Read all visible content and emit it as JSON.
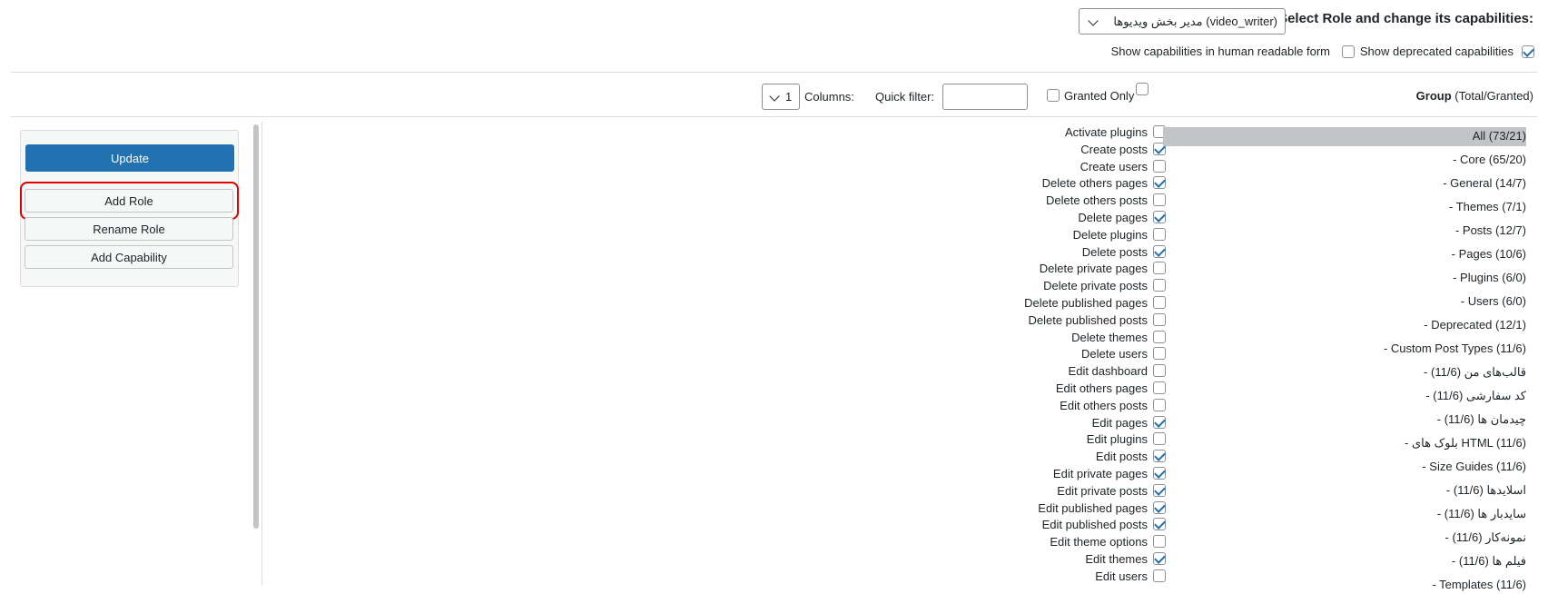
{
  "header": {
    "title": "Select Role and change its capabilities:",
    "role_select_value": "مدیر بخش ویدیوها (video_writer)",
    "show_deprecated_label": "Show deprecated capabilities",
    "show_deprecated_checked": true,
    "human_readable_label": "Show capabilities in human readable form",
    "human_readable_checked": false
  },
  "toolbar": {
    "group_label_bold": "Group",
    "group_label_rest": " (Total/Granted)",
    "granted_only_label": "Granted Only",
    "quick_filter_label": "Quick filter:",
    "quick_filter_value": "",
    "columns_label": "Columns:",
    "columns_value": "1"
  },
  "groups": [
    "All (73/21)",
    "- Core (65/20)",
    "- General (14/7)",
    "- Themes (7/1)",
    "- Posts (12/7)",
    "- Pages (10/6)",
    "- Plugins (6/0)",
    "- Users (6/0)",
    "- Deprecated (12/1)",
    "- Custom Post Types (11/6)",
    "- قالب‌های من (11/6)",
    "- کد سفارشی (11/6)",
    "- چیدمان ها (11/6)",
    "- بلوک های HTML (11/6)",
    "- Size Guides (11/6)",
    "- اسلایدها (11/6)",
    "- سایدبار ها (11/6)",
    "- نمونه‌کار (11/6)",
    "- فیلم ها (11/6)",
    "- Templates (11/6)"
  ],
  "capabilities": [
    {
      "label": "Activate plugins",
      "checked": false
    },
    {
      "label": "Create posts",
      "checked": true
    },
    {
      "label": "Create users",
      "checked": false
    },
    {
      "label": "Delete others pages",
      "checked": true
    },
    {
      "label": "Delete others posts",
      "checked": false
    },
    {
      "label": "Delete pages",
      "checked": true
    },
    {
      "label": "Delete plugins",
      "checked": false
    },
    {
      "label": "Delete posts",
      "checked": true
    },
    {
      "label": "Delete private pages",
      "checked": false
    },
    {
      "label": "Delete private posts",
      "checked": false
    },
    {
      "label": "Delete published pages",
      "checked": false
    },
    {
      "label": "Delete published posts",
      "checked": false
    },
    {
      "label": "Delete themes",
      "checked": false
    },
    {
      "label": "Delete users",
      "checked": false
    },
    {
      "label": "Edit dashboard",
      "checked": false
    },
    {
      "label": "Edit others pages",
      "checked": false
    },
    {
      "label": "Edit others posts",
      "checked": false
    },
    {
      "label": "Edit pages",
      "checked": true
    },
    {
      "label": "Edit plugins",
      "checked": false
    },
    {
      "label": "Edit posts",
      "checked": true
    },
    {
      "label": "Edit private pages",
      "checked": true
    },
    {
      "label": "Edit private posts",
      "checked": true
    },
    {
      "label": "Edit published pages",
      "checked": true
    },
    {
      "label": "Edit published posts",
      "checked": true
    },
    {
      "label": "Edit theme options",
      "checked": false
    },
    {
      "label": "Edit themes",
      "checked": true
    },
    {
      "label": "Edit users",
      "checked": false
    }
  ],
  "actions": {
    "update": "Update",
    "add_role": "Add Role",
    "rename_role": "Rename Role",
    "add_capability": "Add Capability"
  },
  "colors": {
    "primary": "#2271b1",
    "highlight": "#e00000",
    "selected_group_bg": "#c3c4c7"
  }
}
